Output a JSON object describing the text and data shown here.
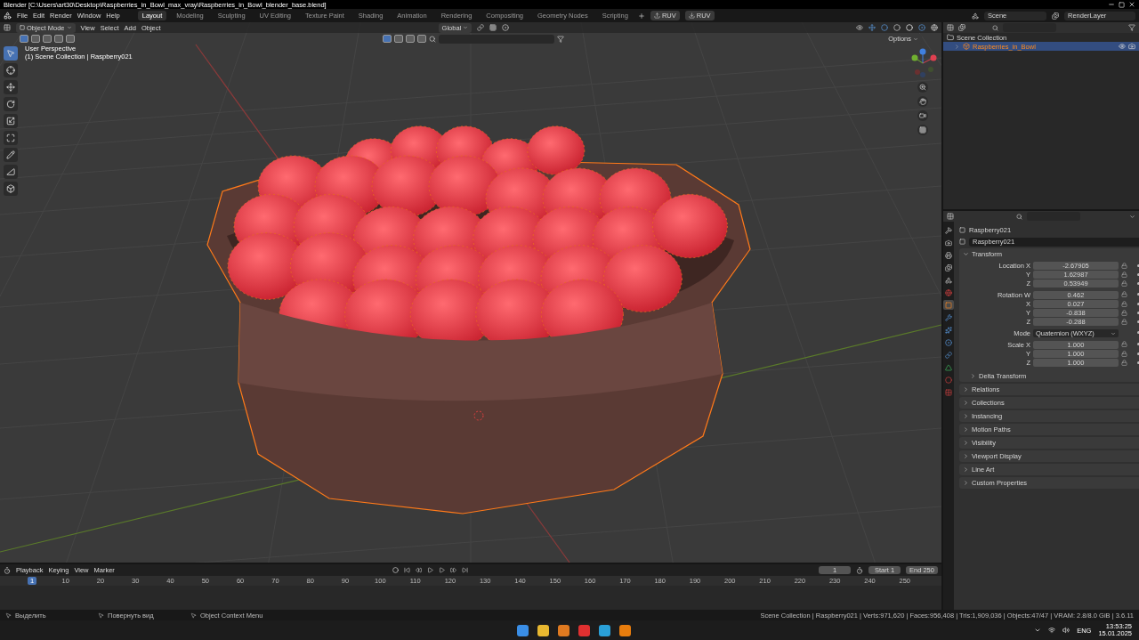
{
  "title_bar": {
    "title": "Blender [C:\\Users\\art30\\Desktop\\Raspberries_in_Bowl_max_vray\\Raspberries_in_Bowl_blender_base.blend]"
  },
  "menu": [
    "File",
    "Edit",
    "Render",
    "Window",
    "Help"
  ],
  "workspaces": [
    {
      "label": "Layout",
      "selected": true
    },
    {
      "label": "Modeling",
      "selected": false
    },
    {
      "label": "Sculpting",
      "selected": false
    },
    {
      "label": "UV Editing",
      "selected": false
    },
    {
      "label": "Texture Paint",
      "selected": false
    },
    {
      "label": "Shading",
      "selected": false
    },
    {
      "label": "Animation",
      "selected": false
    },
    {
      "label": "Rendering",
      "selected": false
    },
    {
      "label": "Compositing",
      "selected": false
    },
    {
      "label": "Geometry Nodes",
      "selected": false
    },
    {
      "label": "Scripting",
      "selected": false
    }
  ],
  "ruv_buttons": [
    {
      "kind": "upload",
      "label": "RUV"
    },
    {
      "kind": "download",
      "label": "RUV"
    }
  ],
  "scene": {
    "scene_name": "Scene",
    "render_layer": "RenderLayer"
  },
  "viewport": {
    "mode": "Object Mode",
    "menus": [
      "View",
      "Select",
      "Add",
      "Object"
    ],
    "orientation": "Global",
    "options": "Options",
    "overlay_lines": [
      "User Perspective",
      "(1) Scene Collection | Raspberry021"
    ],
    "tools": [
      {
        "kind": "select",
        "selected": true
      },
      {
        "kind": "cursor",
        "selected": false
      },
      {
        "kind": "move",
        "selected": false
      },
      {
        "kind": "rotate",
        "selected": false
      },
      {
        "kind": "scale",
        "selected": false
      },
      {
        "kind": "transform",
        "selected": false
      },
      {
        "kind": "annotate",
        "selected": false
      },
      {
        "kind": "measure",
        "selected": false
      },
      {
        "kind": "add_cube",
        "selected": false
      }
    ]
  },
  "outliner": {
    "items": [
      {
        "label": "Scene Collection",
        "selected": false,
        "children": [
          {
            "label": "Raspberries_in_Bowl",
            "selected": true
          }
        ]
      }
    ]
  },
  "properties": {
    "tabs": [
      {
        "kind": "tool",
        "selected": false
      },
      {
        "kind": "render",
        "selected": false
      },
      {
        "kind": "output",
        "selected": false
      },
      {
        "kind": "view_layer",
        "selected": false
      },
      {
        "kind": "scene",
        "selected": false
      },
      {
        "kind": "world",
        "selected": false
      },
      {
        "kind": "object",
        "selected": true
      },
      {
        "kind": "modifier",
        "selected": false
      },
      {
        "kind": "particles",
        "selected": false
      },
      {
        "kind": "physics",
        "selected": false
      },
      {
        "kind": "constraints",
        "selected": false
      },
      {
        "kind": "data",
        "selected": false
      },
      {
        "kind": "material",
        "selected": false
      },
      {
        "kind": "texture",
        "selected": false
      }
    ],
    "object_name": "Raspberry021",
    "data_name": "Raspberry021",
    "transform": {
      "label": "Transform",
      "expanded": true,
      "rows": [
        {
          "kind": "number",
          "label": "Location X",
          "value": "-2.67905"
        },
        {
          "kind": "number",
          "label": "Y",
          "value": "1.62987"
        },
        {
          "kind": "number",
          "label": "Z",
          "value": "0.53949"
        },
        {
          "kind": "number",
          "label": "Rotation W",
          "value": "0.462"
        },
        {
          "kind": "number",
          "label": "X",
          "value": "0.027"
        },
        {
          "kind": "number",
          "label": "Y",
          "value": "-0.838"
        },
        {
          "kind": "number",
          "label": "Z",
          "value": "-0.288"
        },
        {
          "kind": "dropdown",
          "label": "Mode",
          "value": "Quaternion (WXYZ)"
        },
        {
          "kind": "number",
          "label": "Scale X",
          "value": "1.000"
        },
        {
          "kind": "number",
          "label": "Y",
          "value": "1.000"
        },
        {
          "kind": "number",
          "label": "Z",
          "value": "1.000"
        }
      ],
      "subpanel": {
        "label": "Delta Transform",
        "expanded": false
      }
    },
    "panels": [
      {
        "label": "Relations",
        "expanded": false
      },
      {
        "label": "Collections",
        "expanded": false
      },
      {
        "label": "Instancing",
        "expanded": false
      },
      {
        "label": "Motion Paths",
        "expanded": false
      },
      {
        "label": "Visibility",
        "expanded": false
      },
      {
        "label": "Viewport Display",
        "expanded": false
      },
      {
        "label": "Line Art",
        "expanded": false
      },
      {
        "label": "Custom Properties",
        "expanded": false
      }
    ]
  },
  "timeline": {
    "menus": [
      "Playback",
      "Keying",
      "View",
      "Marker"
    ],
    "current_frame": "1",
    "start_label": "Start",
    "start": "1",
    "end_label": "End",
    "end": "250",
    "ticks": [
      {
        "label": "1",
        "selected": true
      },
      {
        "label": "10",
        "selected": false
      },
      {
        "label": "20",
        "selected": false
      },
      {
        "label": "30",
        "selected": false
      },
      {
        "label": "40",
        "selected": false
      },
      {
        "label": "50",
        "selected": false
      },
      {
        "label": "60",
        "selected": false
      },
      {
        "label": "70",
        "selected": false
      },
      {
        "label": "80",
        "selected": false
      },
      {
        "label": "90",
        "selected": false
      },
      {
        "label": "100",
        "selected": false
      },
      {
        "label": "110",
        "selected": false
      },
      {
        "label": "120",
        "selected": false
      },
      {
        "label": "130",
        "selected": false
      },
      {
        "label": "140",
        "selected": false
      },
      {
        "label": "150",
        "selected": false
      },
      {
        "label": "160",
        "selected": false
      },
      {
        "label": "170",
        "selected": false
      },
      {
        "label": "180",
        "selected": false
      },
      {
        "label": "190",
        "selected": false
      },
      {
        "label": "200",
        "selected": false
      },
      {
        "label": "210",
        "selected": false
      },
      {
        "label": "220",
        "selected": false
      },
      {
        "label": "230",
        "selected": false
      },
      {
        "label": "240",
        "selected": false
      },
      {
        "label": "250",
        "selected": false
      }
    ]
  },
  "status_bar": {
    "hints": [
      "Выделить",
      "Повернуть вид",
      "Object Context Menu"
    ],
    "stats": "Scene Collection | Raspberry021 | Verts:971,620 | Faces:956,408 | Tris:1,909,036 | Objects:47/47 | VRAM: 2.8/8.0 GiB | 3.6.11"
  },
  "taskbar": {
    "language": "ENG",
    "time": "13:53:25",
    "date": "15.01.2025"
  }
}
